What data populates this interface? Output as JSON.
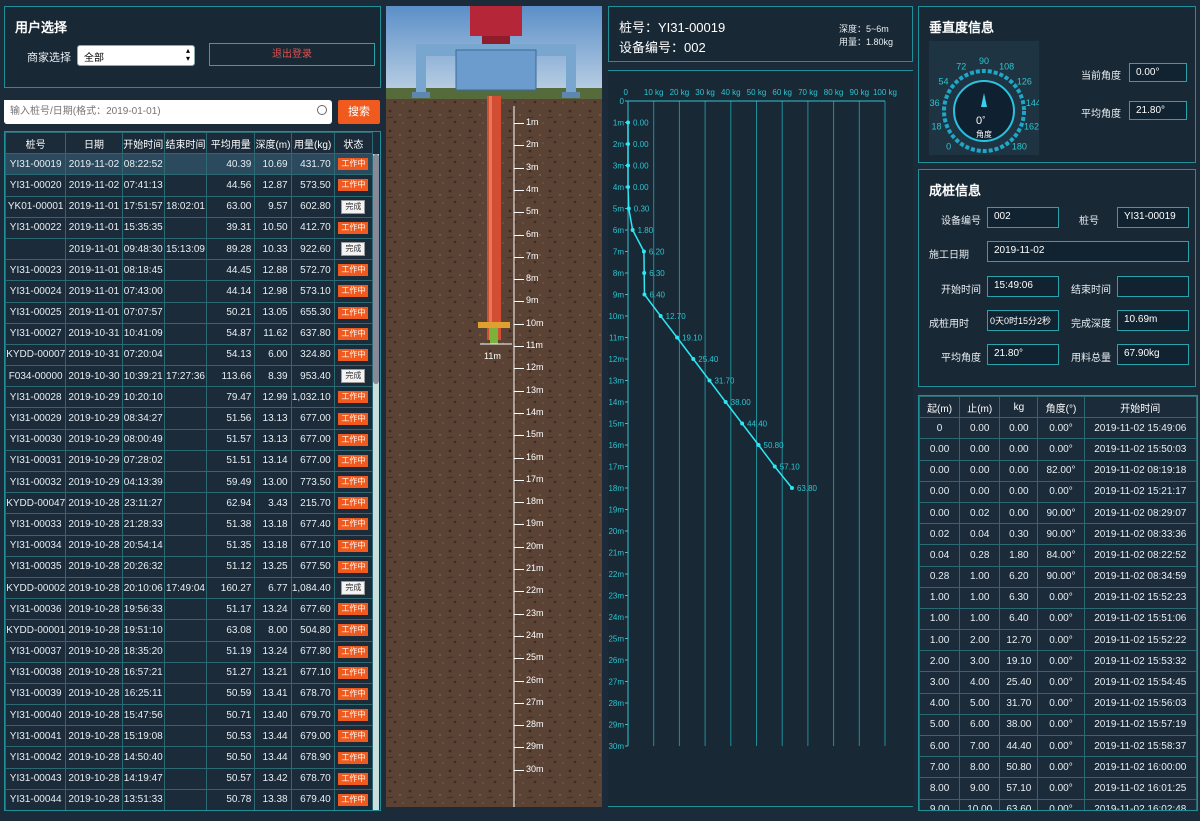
{
  "user_select": {
    "title": "用户选择",
    "merchant_label": "商家选择",
    "merchant_value": "全部",
    "logout": "退出登录"
  },
  "search": {
    "placeholder": "输入桩号/日期(格式：2019-01-01)",
    "button": "搜索"
  },
  "pile_table": {
    "headers": [
      "桩号",
      "日期",
      "开始时间",
      "结束时间",
      "平均用量",
      "深度(m)",
      "用量(kg)",
      "状态"
    ],
    "rows": [
      [
        "YI31-00019",
        "2019-11-02",
        "08:22:52",
        "",
        "40.39",
        "10.69",
        "431.70",
        "工作中"
      ],
      [
        "YI31-00020",
        "2019-11-02",
        "07:41:13",
        "",
        "44.56",
        "12.87",
        "573.50",
        "工作中"
      ],
      [
        "YK01-00001",
        "2019-11-01",
        "17:51:57",
        "18:02:01",
        "63.00",
        "9.57",
        "602.80",
        "完成"
      ],
      [
        "YI31-00022",
        "2019-11-01",
        "15:35:35",
        "",
        "39.31",
        "10.50",
        "412.70",
        "工作中"
      ],
      [
        "",
        "2019-11-01",
        "09:48:30",
        "15:13:09",
        "89.28",
        "10.33",
        "922.60",
        "完成"
      ],
      [
        "YI31-00023",
        "2019-11-01",
        "08:18:45",
        "",
        "44.45",
        "12.88",
        "572.70",
        "工作中"
      ],
      [
        "YI31-00024",
        "2019-11-01",
        "07:43:00",
        "",
        "44.14",
        "12.98",
        "573.10",
        "工作中"
      ],
      [
        "YI31-00025",
        "2019-11-01",
        "07:07:57",
        "",
        "50.21",
        "13.05",
        "655.30",
        "工作中"
      ],
      [
        "YI31-00027",
        "2019-10-31",
        "10:41:09",
        "",
        "54.87",
        "11.62",
        "637.80",
        "工作中"
      ],
      [
        "KYDD-00007",
        "2019-10-31",
        "07:20:04",
        "",
        "54.13",
        "6.00",
        "324.80",
        "工作中"
      ],
      [
        "F034-00000",
        "2019-10-30",
        "10:39:21",
        "17:27:36",
        "113.66",
        "8.39",
        "953.40",
        "完成"
      ],
      [
        "YI31-00028",
        "2019-10-29",
        "10:20:10",
        "",
        "79.47",
        "12.99",
        "1,032.10",
        "工作中"
      ],
      [
        "YI31-00029",
        "2019-10-29",
        "08:34:27",
        "",
        "51.56",
        "13.13",
        "677.00",
        "工作中"
      ],
      [
        "YI31-00030",
        "2019-10-29",
        "08:00:49",
        "",
        "51.57",
        "13.13",
        "677.00",
        "工作中"
      ],
      [
        "YI31-00031",
        "2019-10-29",
        "07:28:02",
        "",
        "51.51",
        "13.14",
        "677.00",
        "工作中"
      ],
      [
        "YI31-00032",
        "2019-10-29",
        "04:13:39",
        "",
        "59.49",
        "13.00",
        "773.50",
        "工作中"
      ],
      [
        "KYDD-00047",
        "2019-10-28",
        "23:11:27",
        "",
        "62.94",
        "3.43",
        "215.70",
        "工作中"
      ],
      [
        "YI31-00033",
        "2019-10-28",
        "21:28:33",
        "",
        "51.38",
        "13.18",
        "677.40",
        "工作中"
      ],
      [
        "YI31-00034",
        "2019-10-28",
        "20:54:14",
        "",
        "51.35",
        "13.18",
        "677.10",
        "工作中"
      ],
      [
        "YI31-00035",
        "2019-10-28",
        "20:26:32",
        "",
        "51.12",
        "13.25",
        "677.50",
        "工作中"
      ],
      [
        "KYDD-00002",
        "2019-10-28",
        "20:10:06",
        "17:49:04",
        "160.27",
        "6.77",
        "1,084.40",
        "完成"
      ],
      [
        "YI31-00036",
        "2019-10-28",
        "19:56:33",
        "",
        "51.17",
        "13.24",
        "677.60",
        "工作中"
      ],
      [
        "KYDD-00001",
        "2019-10-28",
        "19:51:10",
        "",
        "63.08",
        "8.00",
        "504.80",
        "工作中"
      ],
      [
        "YI31-00037",
        "2019-10-28",
        "18:35:20",
        "",
        "51.19",
        "13.24",
        "677.80",
        "工作中"
      ],
      [
        "YI31-00038",
        "2019-10-28",
        "16:57:21",
        "",
        "51.27",
        "13.21",
        "677.10",
        "工作中"
      ],
      [
        "YI31-00039",
        "2019-10-28",
        "16:25:11",
        "",
        "50.59",
        "13.41",
        "678.70",
        "工作中"
      ],
      [
        "YI31-00040",
        "2019-10-28",
        "15:47:56",
        "",
        "50.71",
        "13.40",
        "679.70",
        "工作中"
      ],
      [
        "YI31-00041",
        "2019-10-28",
        "15:19:08",
        "",
        "50.53",
        "13.44",
        "679.00",
        "工作中"
      ],
      [
        "YI31-00042",
        "2019-10-28",
        "14:50:40",
        "",
        "50.50",
        "13.44",
        "678.90",
        "工作中"
      ],
      [
        "YI31-00043",
        "2019-10-28",
        "14:19:47",
        "",
        "50.57",
        "13.42",
        "678.70",
        "工作中"
      ],
      [
        "YI31-00044",
        "2019-10-28",
        "13:51:33",
        "",
        "50.78",
        "13.38",
        "679.40",
        "工作中"
      ]
    ]
  },
  "ruler": {
    "labels": [
      "1m",
      "2m",
      "3m",
      "4m",
      "5m",
      "6m",
      "7m",
      "8m",
      "9m",
      "10m",
      "11m",
      "12m",
      "13m",
      "14m",
      "15m",
      "16m",
      "17m",
      "18m",
      "19m",
      "20m",
      "21m",
      "22m",
      "23m",
      "24m",
      "25m",
      "26m",
      "27m",
      "28m",
      "29m",
      "30m"
    ],
    "drill_depth_label": "11m",
    "drill_depth_m": 10.69
  },
  "pile_header": {
    "pile_label": "桩号：YI31-00019",
    "device_label": "设备编号：002",
    "depth_label": "深度：5~6m",
    "usage_label": "用量：1.80kg"
  },
  "chart_data": {
    "type": "line",
    "x_ticks": [
      "0",
      "10 kg",
      "20 kg",
      "30 kg",
      "40 kg",
      "50 kg",
      "60 kg",
      "70 kg",
      "80 kg",
      "90 kg",
      "100 kg"
    ],
    "y_ticks": [
      "0",
      "1m",
      "2m",
      "3m",
      "4m",
      "5m",
      "6m",
      "7m",
      "8m",
      "9m",
      "10m",
      "11m",
      "12m",
      "13m",
      "14m",
      "15m",
      "16m",
      "17m",
      "18m",
      "19m",
      "20m",
      "21m",
      "22m",
      "23m",
      "24m",
      "25m",
      "26m",
      "27m",
      "28m",
      "29m",
      "30m"
    ],
    "xlim": [
      0,
      100
    ],
    "ylim": [
      0,
      30
    ],
    "points": [
      [
        0,
        1
      ],
      [
        0,
        2
      ],
      [
        0,
        3
      ],
      [
        0,
        4
      ],
      [
        0.3,
        5
      ],
      [
        1.8,
        6
      ],
      [
        6.2,
        7
      ],
      [
        6.3,
        8
      ],
      [
        6.4,
        9
      ],
      [
        12.7,
        10
      ],
      [
        19.1,
        11
      ],
      [
        25.4,
        12
      ],
      [
        31.7,
        13
      ],
      [
        38.0,
        14
      ],
      [
        44.4,
        15
      ],
      [
        50.8,
        16
      ],
      [
        57.1,
        17
      ],
      [
        63.8,
        18
      ]
    ],
    "labels": [
      "0.00",
      "0.00",
      "0.00",
      "0.00",
      "0.30",
      "1.80",
      "6.20",
      "6.30",
      "6.40",
      "12.70",
      "19.10",
      "25.40",
      "31.70",
      "38.00",
      "44.40",
      "50.80",
      "57.10",
      "63.80"
    ],
    "color": "#2ee6f0"
  },
  "verticality": {
    "title": "垂直度信息",
    "gauge_ticks": [
      "0",
      "18",
      "36",
      "54",
      "72",
      "90",
      "108",
      "126",
      "144",
      "162",
      "180"
    ],
    "gauge_value": "0",
    "gauge_unit": "°",
    "gauge_caption": "角度",
    "current_label": "当前角度",
    "current_value": "0.00°",
    "avg_label": "平均角度",
    "avg_value": "21.80°"
  },
  "pile_info": {
    "title": "成桩信息",
    "device_label": "设备编号",
    "device_value": "002",
    "pile_label": "桩号",
    "pile_value": "YI31-00019",
    "date_label": "施工日期",
    "date_value": "2019-11-02",
    "start_label": "开始时间",
    "start_value": "15:49:06",
    "end_label": "结束时间",
    "end_value": "",
    "duration_label": "成桩用时",
    "duration_value": "0天0时15分2秒",
    "depth_label": "完成深度",
    "depth_value": "10.69m",
    "angle_label": "平均角度",
    "angle_value": "21.80°",
    "total_label": "用料总量",
    "total_value": "67.90kg"
  },
  "segment_table": {
    "headers": [
      "起(m)",
      "止(m)",
      "kg",
      "角度(°)",
      "开始时间"
    ],
    "rows": [
      [
        "0",
        "0.00",
        "0.00",
        "0.00°",
        "2019-11-02 15:49:06"
      ],
      [
        "0.00",
        "0.00",
        "0.00",
        "0.00°",
        "2019-11-02 15:50:03"
      ],
      [
        "0.00",
        "0.00",
        "0.00",
        "82.00°",
        "2019-11-02 08:19:18"
      ],
      [
        "0.00",
        "0.00",
        "0.00",
        "0.00°",
        "2019-11-02 15:21:17"
      ],
      [
        "0.00",
        "0.02",
        "0.00",
        "90.00°",
        "2019-11-02 08:29:07"
      ],
      [
        "0.02",
        "0.04",
        "0.30",
        "90.00°",
        "2019-11-02 08:33:36"
      ],
      [
        "0.04",
        "0.28",
        "1.80",
        "84.00°",
        "2019-11-02 08:22:52"
      ],
      [
        "0.28",
        "1.00",
        "6.20",
        "90.00°",
        "2019-11-02 08:34:59"
      ],
      [
        "1.00",
        "1.00",
        "6.30",
        "0.00°",
        "2019-11-02 15:52:23"
      ],
      [
        "1.00",
        "1.00",
        "6.40",
        "0.00°",
        "2019-11-02 15:51:06"
      ],
      [
        "1.00",
        "2.00",
        "12.70",
        "0.00°",
        "2019-11-02 15:52:22"
      ],
      [
        "2.00",
        "3.00",
        "19.10",
        "0.00°",
        "2019-11-02 15:53:32"
      ],
      [
        "3.00",
        "4.00",
        "25.40",
        "0.00°",
        "2019-11-02 15:54:45"
      ],
      [
        "4.00",
        "5.00",
        "31.70",
        "0.00°",
        "2019-11-02 15:56:03"
      ],
      [
        "5.00",
        "6.00",
        "38.00",
        "0.00°",
        "2019-11-02 15:57:19"
      ],
      [
        "6.00",
        "7.00",
        "44.40",
        "0.00°",
        "2019-11-02 15:58:37"
      ],
      [
        "7.00",
        "8.00",
        "50.80",
        "0.00°",
        "2019-11-02 16:00:00"
      ],
      [
        "8.00",
        "9.00",
        "57.10",
        "0.00°",
        "2019-11-02 16:01:25"
      ],
      [
        "9.00",
        "10.00",
        "63.60",
        "0.00°",
        "2019-11-02 16:02:48"
      ]
    ]
  }
}
